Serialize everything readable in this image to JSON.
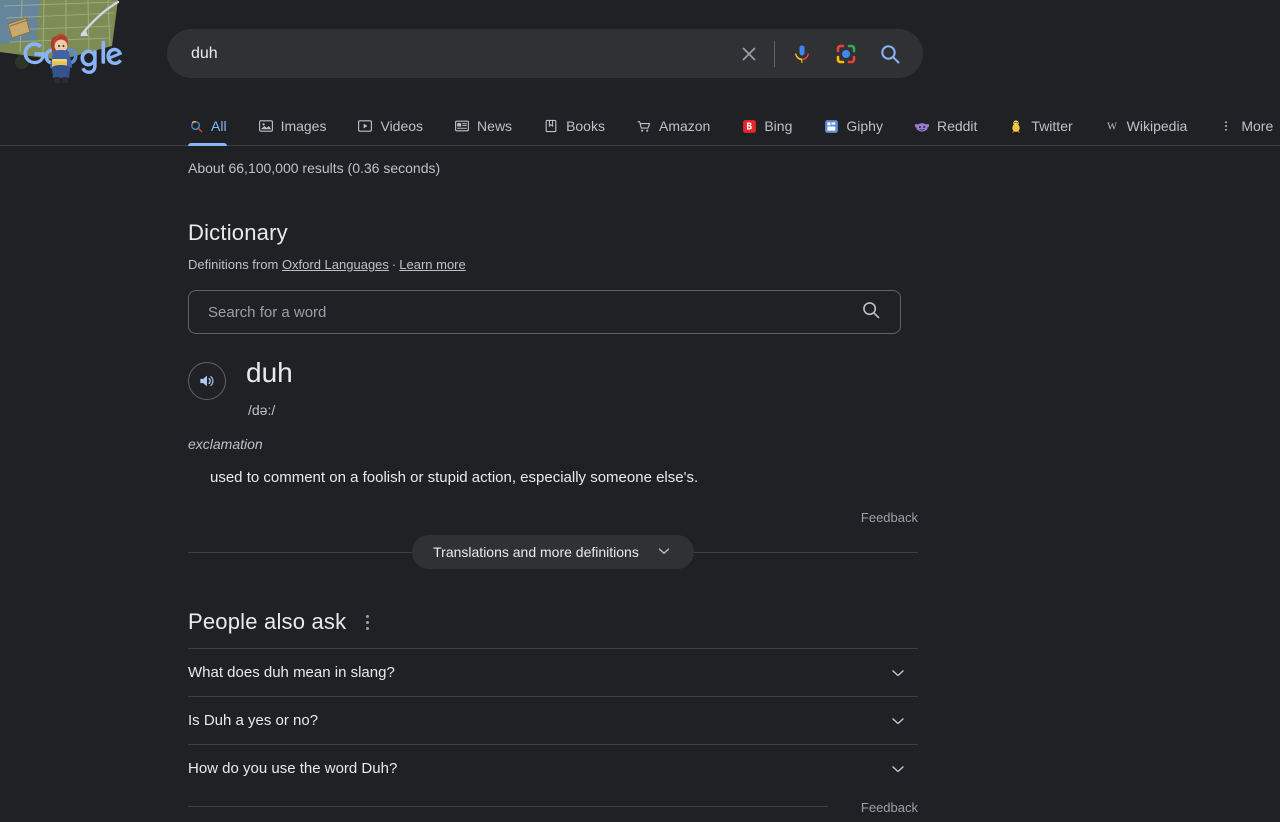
{
  "theme": {
    "page_bg": "#202124",
    "surface_bg": "#303134",
    "text_primary": "#e8eaed",
    "text_secondary": "#bdc1c6",
    "text_muted": "#9aa0a6",
    "accent_blue": "#8ab4f8",
    "divider": "#3c4043"
  },
  "header": {
    "logo_alt": "Google",
    "logo_letters": "Google",
    "doodle_name": "google-doodle"
  },
  "search": {
    "value": "duh",
    "placeholder": "",
    "clear_icon": "close-x-icon",
    "mic_icon": "microphone-icon",
    "lens_icon": "google-lens-icon",
    "submit_icon": "search-icon"
  },
  "nav": {
    "tabs": [
      {
        "label": "All",
        "icon": "search-icon",
        "active": true
      },
      {
        "label": "Images",
        "icon": "image-icon",
        "active": false
      },
      {
        "label": "Videos",
        "icon": "video-icon",
        "active": false
      },
      {
        "label": "News",
        "icon": "news-icon",
        "active": false
      },
      {
        "label": "Books",
        "icon": "book-icon",
        "active": false
      },
      {
        "label": "Amazon",
        "icon": "shopping-cart-icon",
        "active": false
      },
      {
        "label": "Bing",
        "icon": "bing-icon",
        "active": false
      },
      {
        "label": "Giphy",
        "icon": "giphy-icon",
        "active": false
      },
      {
        "label": "Reddit",
        "icon": "reddit-icon",
        "active": false
      },
      {
        "label": "Twitter",
        "icon": "twitter-bird-icon",
        "active": false
      },
      {
        "label": "Wikipedia",
        "icon": "wikipedia-w-icon",
        "active": false
      },
      {
        "label": "More",
        "icon": "kebab-menu-icon",
        "active": false
      }
    ]
  },
  "results": {
    "count_text": "About 66,100,000 results (0.36 seconds)"
  },
  "dictionary": {
    "title": "Dictionary",
    "attribution_prefix": "Definitions from",
    "source_link": "Oxford Languages",
    "separator": "·",
    "learn_more": "Learn more",
    "word_search_placeholder": "Search for a word",
    "word_search_value": "",
    "word_search_icon": "search-icon",
    "speaker_icon": "speaker-volume-icon",
    "headword": "duh",
    "phonetic": "/də:/",
    "part_of_speech": "exclamation",
    "definition": "used to comment on a foolish or stupid action, especially someone else's.",
    "feedback_label": "Feedback",
    "expand_label": "Translations and more definitions",
    "expand_icon": "chevron-down-icon"
  },
  "people_also_ask": {
    "title": "People also ask",
    "menu_icon": "kebab-menu-icon",
    "questions": [
      {
        "text": "What does duh mean in slang?",
        "icon": "chevron-down-icon"
      },
      {
        "text": "Is Duh a yes or no?",
        "icon": "chevron-down-icon"
      },
      {
        "text": "How do you use the word Duh?",
        "icon": "chevron-down-icon"
      }
    ],
    "feedback_label": "Feedback"
  }
}
